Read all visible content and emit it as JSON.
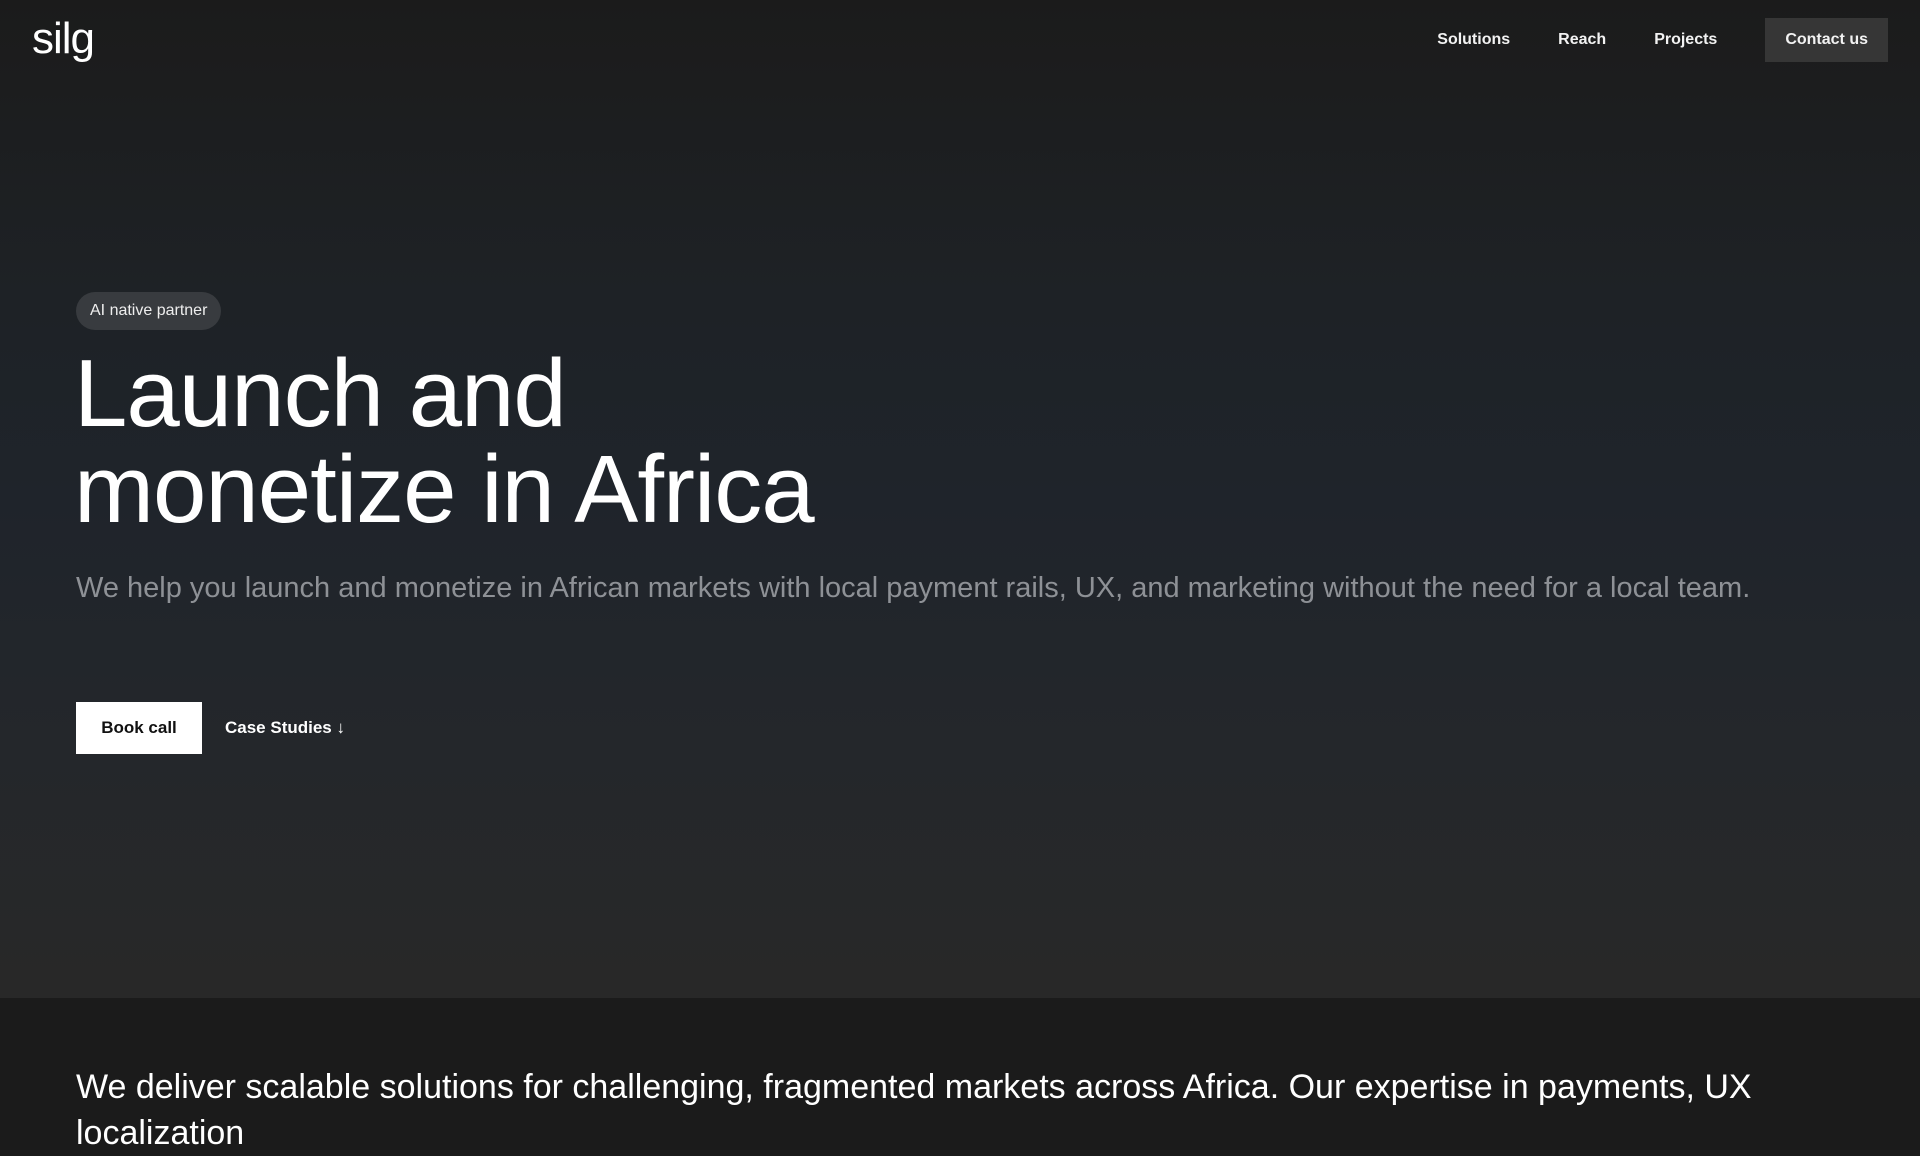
{
  "header": {
    "logo": "silg",
    "nav": [
      "Solutions",
      "Reach",
      "Projects"
    ],
    "contact": "Contact us"
  },
  "hero": {
    "badge": "AI native partner",
    "title_line1": "Launch and",
    "title_line2": "monetize in Africa",
    "subtitle": "We help you launch and monetize in African markets with local payment rails, UX, and marketing without the need for a local team.",
    "book_call": "Book call",
    "case_studies": "Case Studies ↓"
  },
  "next_section": {
    "text": "We deliver scalable solutions for challenging, fragmented markets across Africa. Our expertise in payments, UX localization"
  }
}
